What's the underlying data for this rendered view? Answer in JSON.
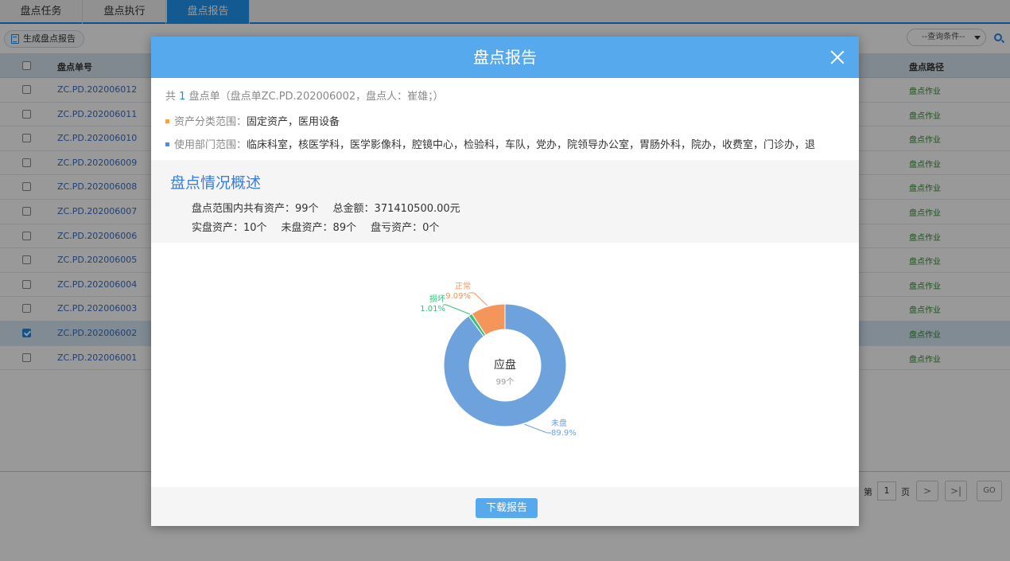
{
  "tabs": [
    {
      "label": "盘点任务",
      "active": false
    },
    {
      "label": "盘点执行",
      "active": false
    },
    {
      "label": "盘点报告",
      "active": true
    }
  ],
  "toolbar": {
    "generate_label": "生成盘点报告",
    "query_placeholder": "--查询条件--"
  },
  "grid": {
    "columns": {
      "number": "盘点单号",
      "path": "盘点路径"
    },
    "rows": [
      {
        "no": "ZC.PD.202006012",
        "path": "盘点作业",
        "checked": false
      },
      {
        "no": "ZC.PD.202006011",
        "path": "盘点作业",
        "checked": false
      },
      {
        "no": "ZC.PD.202006010",
        "path": "盘点作业",
        "checked": false
      },
      {
        "no": "ZC.PD.202006009",
        "path": "盘点作业",
        "checked": false
      },
      {
        "no": "ZC.PD.202006008",
        "path": "盘点作业",
        "checked": false
      },
      {
        "no": "ZC.PD.202006007",
        "path": "盘点作业",
        "checked": false
      },
      {
        "no": "ZC.PD.202006006",
        "path": "盘点作业",
        "checked": false
      },
      {
        "no": "ZC.PD.202006005",
        "path": "盘点作业",
        "checked": false
      },
      {
        "no": "ZC.PD.202006004",
        "path": "盘点作业",
        "checked": false
      },
      {
        "no": "ZC.PD.202006003",
        "path": "盘点作业",
        "checked": false
      },
      {
        "no": "ZC.PD.202006002",
        "path": "盘点作业",
        "checked": true
      },
      {
        "no": "ZC.PD.202006001",
        "path": "盘点作业",
        "checked": false
      }
    ]
  },
  "pager": {
    "page_prefix": "第",
    "page_value": "1",
    "page_suffix": "页",
    "next_label": ">",
    "last_label": ">|",
    "go_label": "GO"
  },
  "modal": {
    "title": "盘点报告",
    "summary_prefix": "共",
    "summary_count": "1",
    "summary_suffix": "盘点单（盘点单ZC.PD.202006002，盘点人：崔雄；）",
    "category_label": "资产分类范围：",
    "category_value": "固定资产，医用设备",
    "dept_label": "使用部门范围：",
    "dept_value": "临床科室，核医学科，医学影像科，腔镜中心，检验科，车队，党办，院领导办公室，胃肠外科，院办，收费室，门诊办，退",
    "overview_title": "盘点情况概述",
    "total_assets": "盘点范围内共有资产：99个",
    "total_amount": "总金额：371410500.00元",
    "counted": "实盘资产：10个",
    "uncounted": "未盘资产：89个",
    "loss": "盘亏资产：0个",
    "download_label": "下载报告",
    "colors": {
      "accent": "#56a9ec",
      "bullet_orange": "#f5a04c",
      "bullet_blue": "#4a8fe0"
    }
  },
  "chart_data": {
    "type": "pie",
    "center_title": "应盘",
    "center_sub": "99个",
    "slices": [
      {
        "name": "未盘",
        "value": 89,
        "label": "89.9%",
        "color": "#6ea2dc"
      },
      {
        "name": "损坏",
        "value": 1,
        "label": "1.01%",
        "color": "#35c27a"
      },
      {
        "name": "正常",
        "value": 9,
        "label": "9.09%",
        "color": "#f4955a"
      }
    ]
  }
}
